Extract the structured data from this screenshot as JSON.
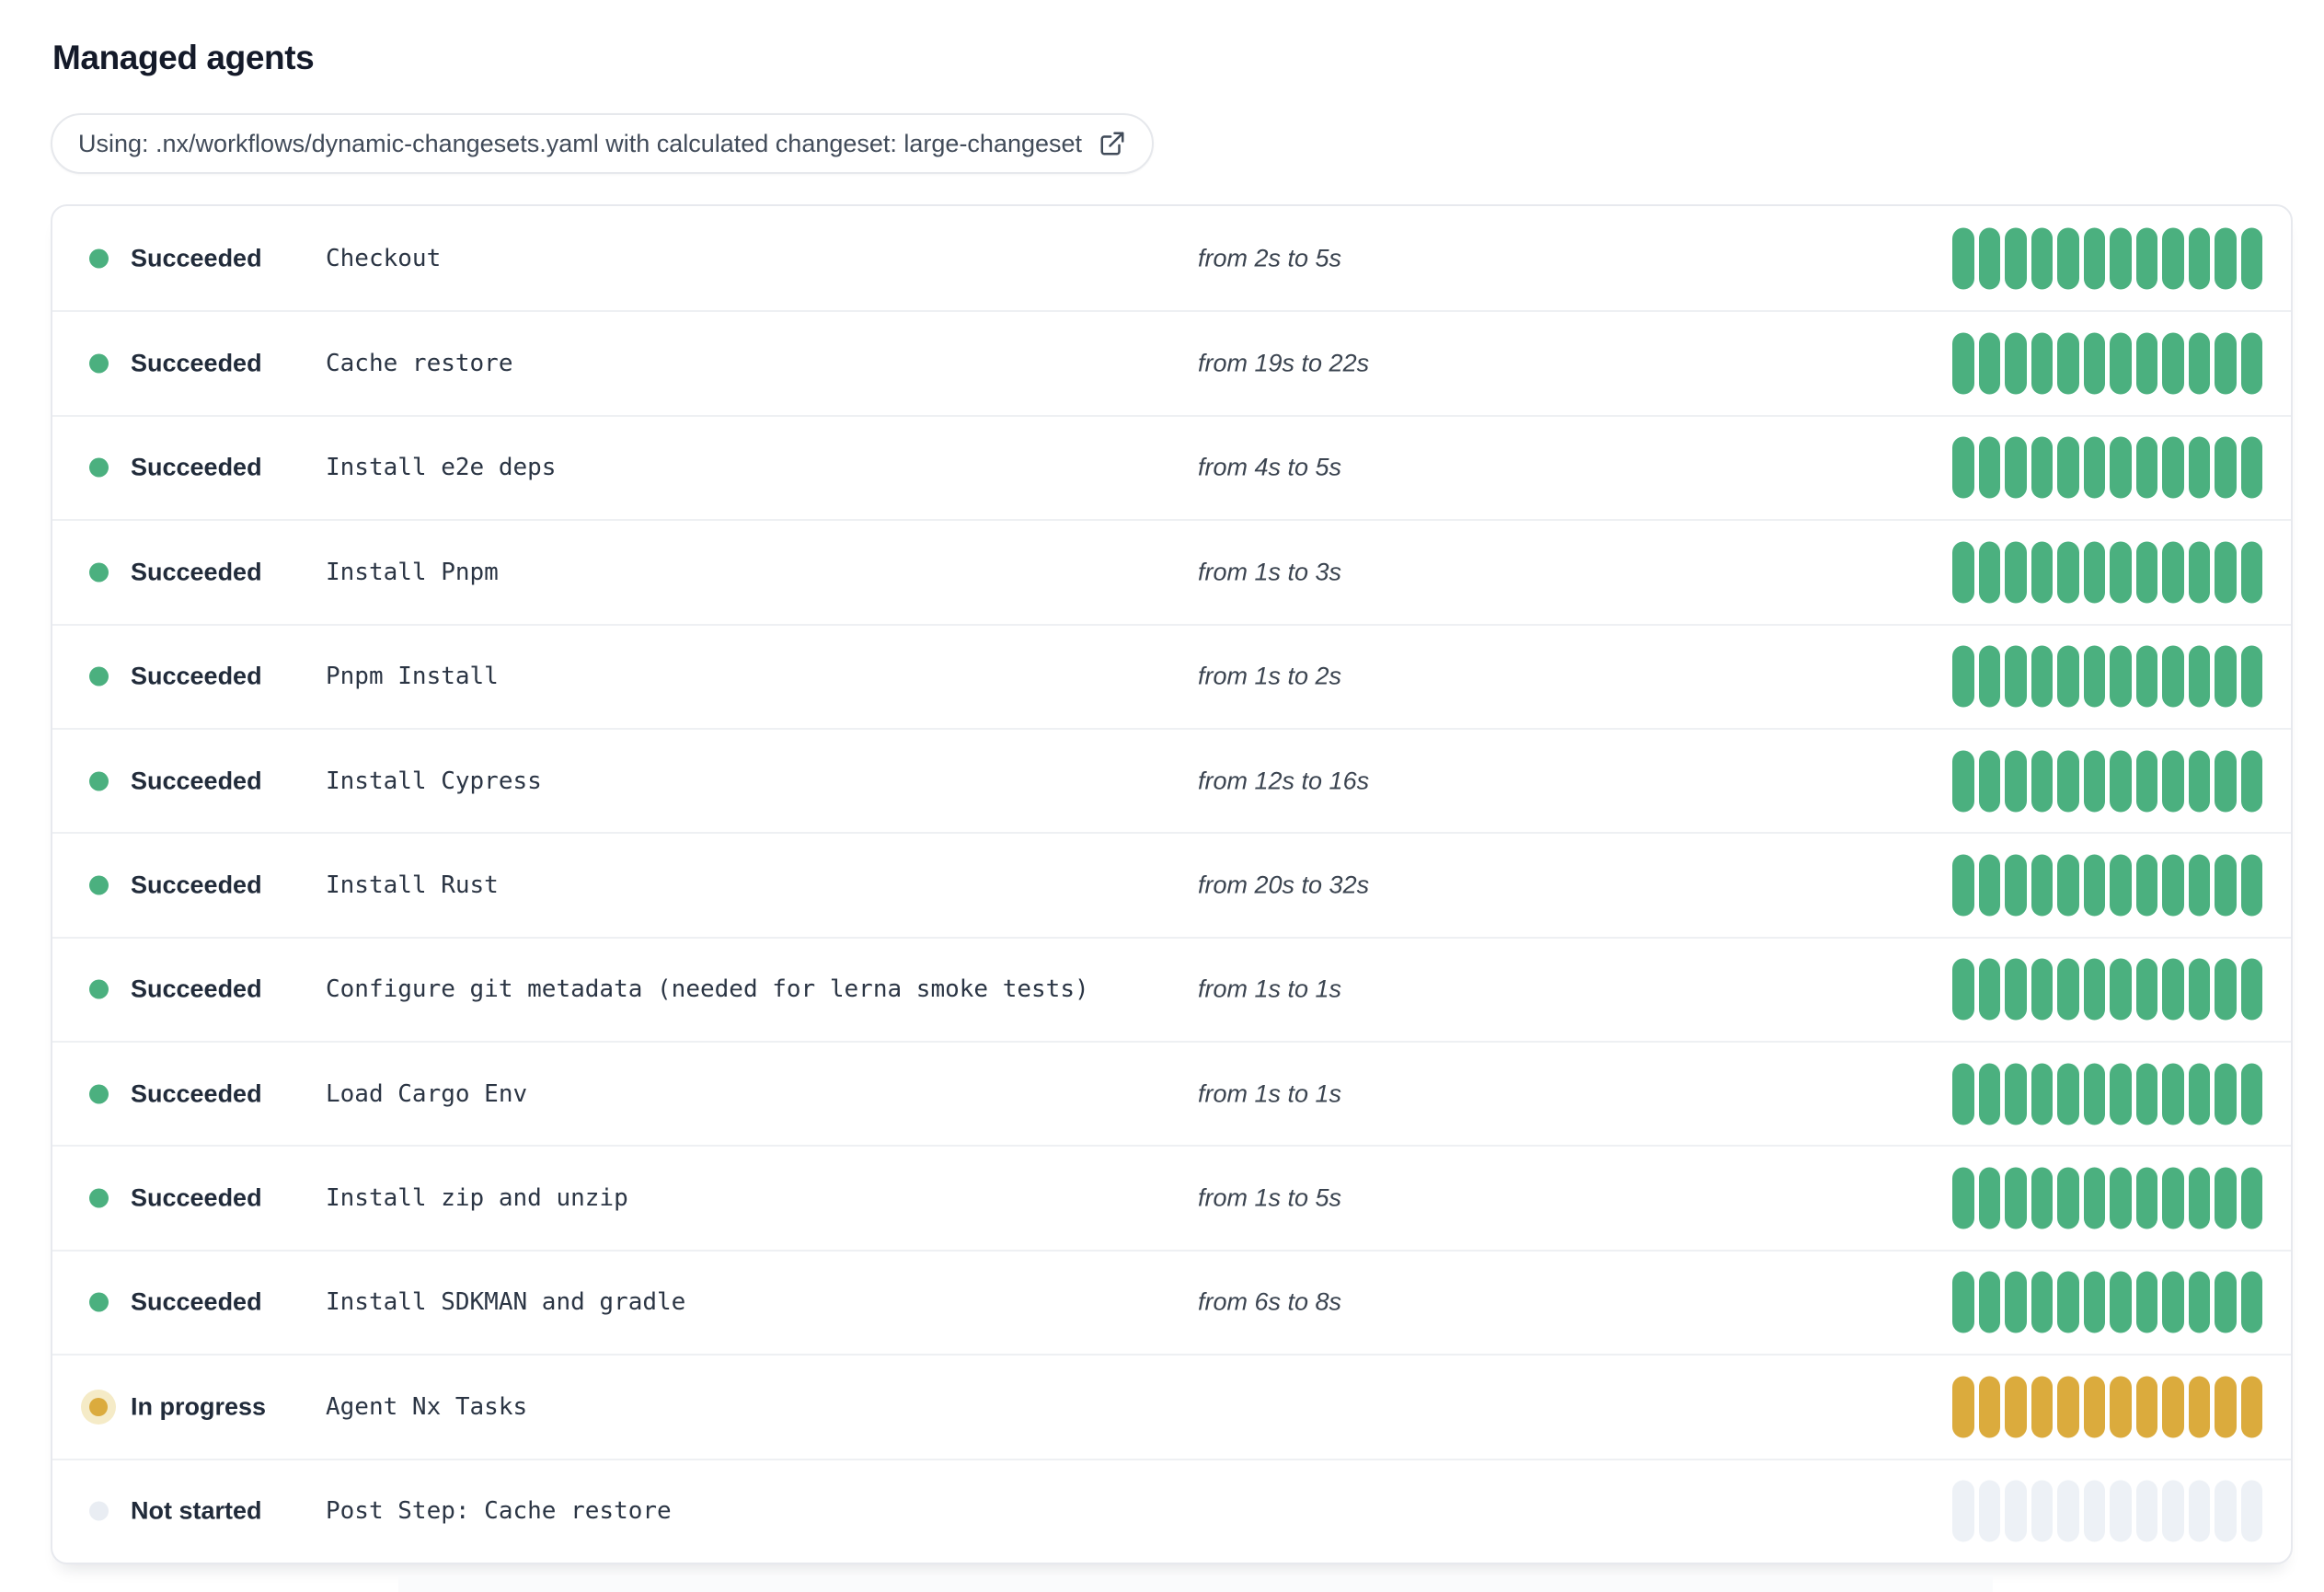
{
  "page": {
    "title": "Managed agents"
  },
  "workflow_banner": {
    "text": "Using: .nx/workflows/dynamic-changesets.yaml with calculated changeset: large-changeset",
    "icon": "external-link-icon"
  },
  "colors": {
    "succeeded": "#4BB07F",
    "in_progress": "#DBAB3D",
    "in_progress_halo": "#F5EBC7",
    "not_started_segment": "#EDF1F6",
    "not_started_dot": "#E9EDF3"
  },
  "agents": {
    "segment_count": 12,
    "rows": [
      {
        "status": "succeeded",
        "status_label": "Succeeded",
        "name": "Checkout",
        "duration": "from 2s to 5s"
      },
      {
        "status": "succeeded",
        "status_label": "Succeeded",
        "name": "Cache restore",
        "duration": "from 19s to 22s"
      },
      {
        "status": "succeeded",
        "status_label": "Succeeded",
        "name": "Install e2e deps",
        "duration": "from 4s to 5s"
      },
      {
        "status": "succeeded",
        "status_label": "Succeeded",
        "name": "Install Pnpm",
        "duration": "from 1s to 3s"
      },
      {
        "status": "succeeded",
        "status_label": "Succeeded",
        "name": "Pnpm Install",
        "duration": "from 1s to 2s"
      },
      {
        "status": "succeeded",
        "status_label": "Succeeded",
        "name": "Install Cypress",
        "duration": "from 12s to 16s"
      },
      {
        "status": "succeeded",
        "status_label": "Succeeded",
        "name": "Install Rust",
        "duration": "from 20s to 32s"
      },
      {
        "status": "succeeded",
        "status_label": "Succeeded",
        "name": "Configure git metadata (needed for lerna smoke tests)",
        "duration": "from 1s to 1s"
      },
      {
        "status": "succeeded",
        "status_label": "Succeeded",
        "name": "Load Cargo Env",
        "duration": "from 1s to 1s"
      },
      {
        "status": "succeeded",
        "status_label": "Succeeded",
        "name": "Install zip and unzip",
        "duration": "from 1s to 5s"
      },
      {
        "status": "succeeded",
        "status_label": "Succeeded",
        "name": "Install SDKMAN and gradle",
        "duration": "from 6s to 8s"
      },
      {
        "status": "in-progress",
        "status_label": "In progress",
        "name": "Agent Nx Tasks",
        "duration": ""
      },
      {
        "status": "not-started",
        "status_label": "Not started",
        "name": "Post Step: Cache restore",
        "duration": ""
      }
    ]
  }
}
